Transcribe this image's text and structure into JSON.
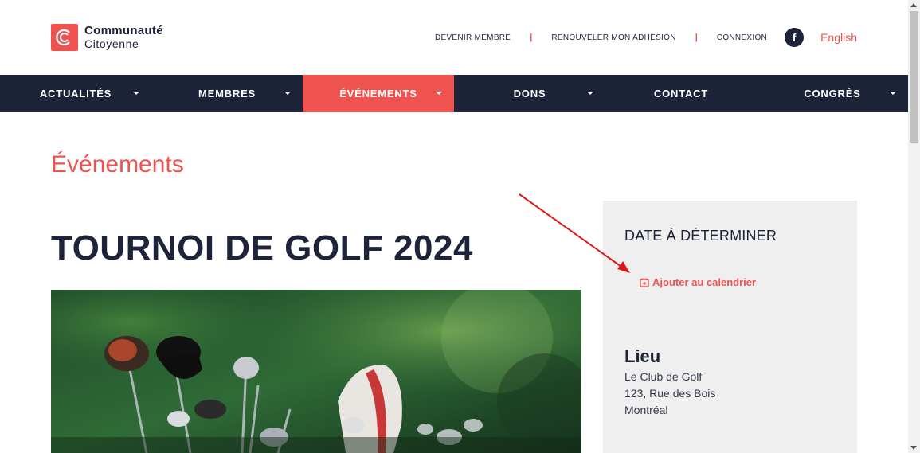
{
  "brand": {
    "line1": "Communauté",
    "line2": "Citoyenne",
    "color": "#ef5350"
  },
  "toplinks": {
    "devenir": "DEVENIR MEMBRE",
    "renouveler": "RENOUVELER MON ADHÉSION",
    "connexion": "CONNEXION",
    "separator": "|",
    "facebook_icon": "facebook-icon",
    "language": "English"
  },
  "nav": {
    "items": [
      {
        "label": "ACTUALITÉS",
        "has_dropdown": true,
        "active": false
      },
      {
        "label": "MEMBRES",
        "has_dropdown": true,
        "active": false
      },
      {
        "label": "ÉVÉNEMENTS",
        "has_dropdown": true,
        "active": true
      },
      {
        "label": "DONS",
        "has_dropdown": true,
        "active": false
      },
      {
        "label": "CONTACT",
        "has_dropdown": false,
        "active": false
      },
      {
        "label": "CONGRÈS",
        "has_dropdown": true,
        "active": false
      }
    ],
    "background": "#1d2338",
    "active_background": "#ef5350"
  },
  "main": {
    "section_title": "Événements",
    "event_title": "TOURNOI DE GOLF 2024"
  },
  "sidebar": {
    "date": "DATE À DÉTERMINER",
    "add_calendar": "Ajouter au calendrier",
    "location_title": "Lieu",
    "location_lines": [
      "Le Club de Golf",
      "123, Rue des Bois",
      "Montréal"
    ]
  }
}
